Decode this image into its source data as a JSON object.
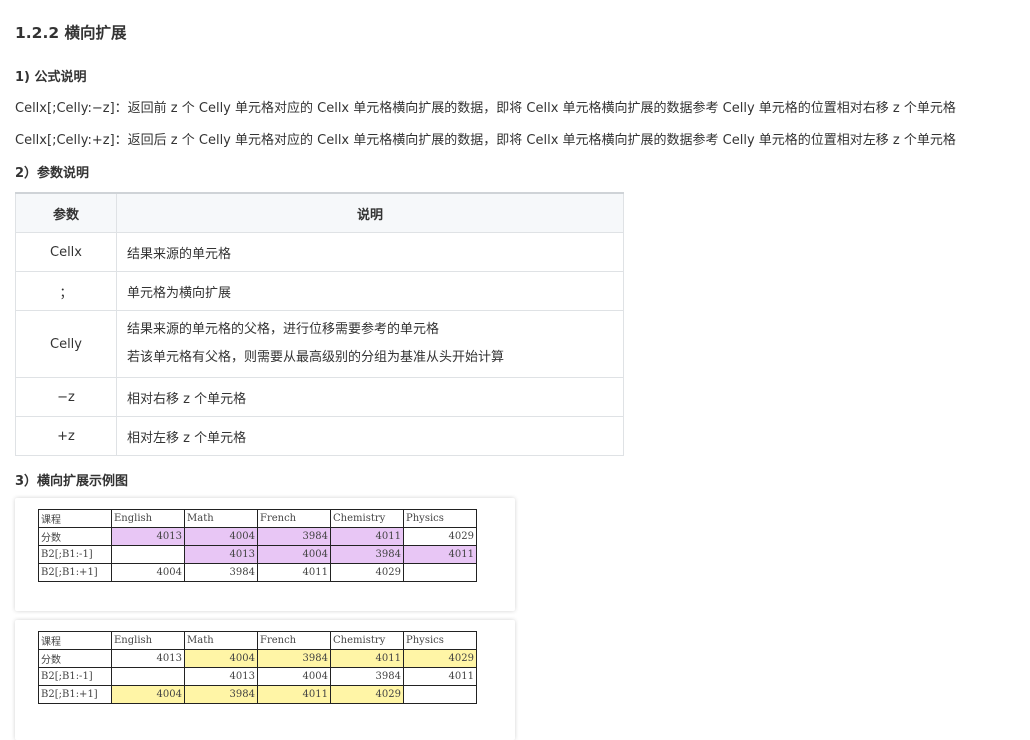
{
  "section_title": "1.2.2 横向扩展",
  "formula_heading": "1) 公式说明",
  "formula_lines": [
    "Cellx[;Celly:−z]：返回前 z 个 Celly 单元格对应的 Cellx 单元格横向扩展的数据，即将 Cellx 单元格横向扩展的数据参考 Celly 单元格的位置相对右移 z 个单元格",
    "Cellx[;Celly:+z]：返回后 z 个 Celly 单元格对应的 Cellx 单元格横向扩展的数据，即将 Cellx 单元格横向扩展的数据参考 Celly 单元格的位置相对左移 z 个单元格"
  ],
  "param_heading": "2）参数说明",
  "param_table": {
    "headers": [
      "参数",
      "说明"
    ],
    "rows": [
      {
        "param": "Cellx",
        "desc": "结果来源的单元格"
      },
      {
        "param": "；",
        "desc": "单元格为横向扩展"
      },
      {
        "param": "Celly",
        "desc": "结果来源的单元格的父格，进行位移需要参考的单元格",
        "desc2": "若该单元格有父格，则需要从最高级别的分组为基准从头开始计算"
      },
      {
        "param": "−z",
        "desc": "相对右移 z 个单元格"
      },
      {
        "param": "+z",
        "desc": "相对左移 z 个单元格"
      }
    ]
  },
  "example_heading": "3）横向扩展示例图",
  "colors": {
    "highlight_purple": "#e8c6f5",
    "highlight_yellow": "#fff5a6",
    "table_header_bg": "#f6f8fa"
  },
  "example1": {
    "rows": [
      [
        "课程",
        "English",
        "Math",
        "French",
        "Chemistry",
        "Physics"
      ],
      [
        "分数",
        "4013",
        "4004",
        "3984",
        "4011",
        "4029"
      ],
      [
        "B2[;B1:-1]",
        "",
        "4013",
        "4004",
        "3984",
        "4011"
      ],
      [
        "B2[;B1:+1]",
        "4004",
        "3984",
        "4011",
        "4029",
        ""
      ]
    ]
  },
  "example2": {
    "rows": [
      [
        "课程",
        "English",
        "Math",
        "French",
        "Chemistry",
        "Physics"
      ],
      [
        "分数",
        "4013",
        "4004",
        "3984",
        "4011",
        "4029"
      ],
      [
        "B2[;B1:-1]",
        "",
        "4013",
        "4004",
        "3984",
        "4011"
      ],
      [
        "B2[;B1:+1]",
        "4004",
        "3984",
        "4011",
        "4029",
        ""
      ]
    ]
  }
}
